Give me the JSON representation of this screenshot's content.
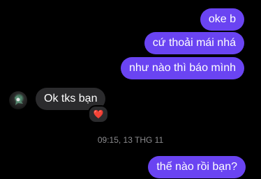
{
  "messages": [
    {
      "text": "oke b",
      "side": "sent"
    },
    {
      "text": "cứ thoải mái nhá",
      "side": "sent"
    },
    {
      "text": "như nào thì báo mình",
      "side": "sent"
    },
    {
      "text": "Ok tks bạn",
      "side": "received",
      "reaction": "❤️"
    },
    {
      "text": "thế nào rồi bạn?",
      "side": "sent"
    }
  ],
  "timestamp": "09:15, 13 THG 11",
  "colors": {
    "background": "#000000",
    "sent_bubble": "#6a44f2",
    "received_bubble": "#2b2b2d",
    "timestamp_text": "#8b8b8e"
  },
  "icons": {
    "contact_avatar": "avatar-icon",
    "reaction": "heart-icon"
  }
}
